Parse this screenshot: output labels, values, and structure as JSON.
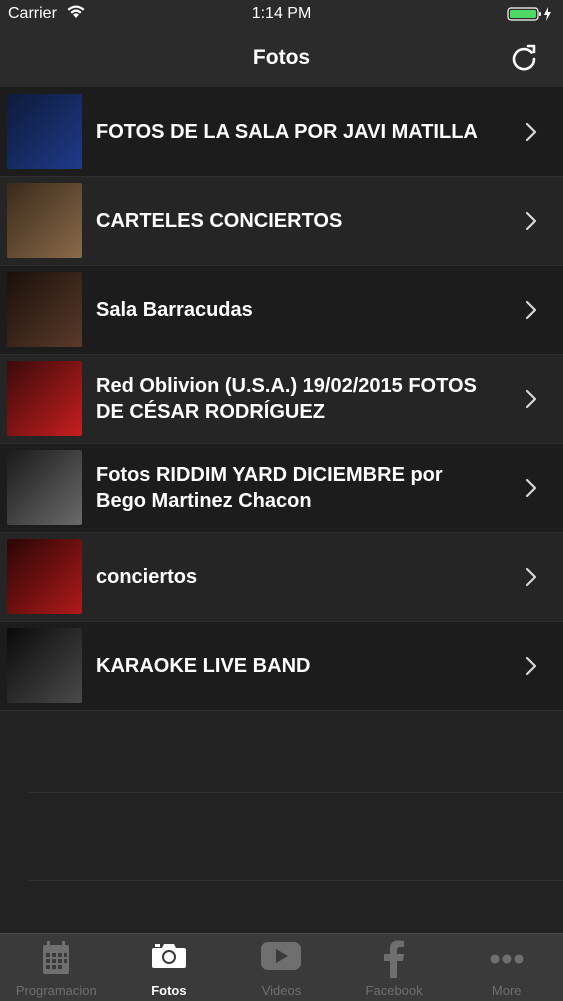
{
  "status_bar": {
    "carrier": "Carrier",
    "time": "1:14 PM",
    "wifi_icon": "wifi-icon",
    "battery_icon": "battery-charging-icon",
    "battery_color": "#4cd964"
  },
  "nav": {
    "title": "Fotos",
    "refresh_icon": "refresh-icon"
  },
  "albums": [
    {
      "label": "FOTOS DE LA SALA POR JAVI MATILLA",
      "thumb_colors": [
        "#0d1a3a",
        "#1f3a8a"
      ]
    },
    {
      "label": "CARTELES CONCIERTOS",
      "thumb_colors": [
        "#3a2a1a",
        "#8a6a4a"
      ]
    },
    {
      "label": "Sala Barracudas",
      "thumb_colors": [
        "#1a0f0a",
        "#5a3a2a"
      ]
    },
    {
      "label": "Red Oblivion (U.S.A.) 19/02/2015 FOTOS DE CÉSAR RODRÍGUEZ",
      "thumb_colors": [
        "#3a0a0a",
        "#c81e1e"
      ]
    },
    {
      "label": "Fotos RIDDIM YARD DICIEMBRE por Bego Martinez Chacon",
      "thumb_colors": [
        "#1a1a1a",
        "#6a6a6a"
      ]
    },
    {
      "label": "conciertos",
      "thumb_colors": [
        "#2a0505",
        "#b01a1a"
      ]
    },
    {
      "label": "KARAOKE LIVE BAND",
      "thumb_colors": [
        "#0a0a0a",
        "#4a4a4a"
      ]
    }
  ],
  "tabs": [
    {
      "label": "Programacion",
      "icon": "calendar-icon",
      "active": false
    },
    {
      "label": "Fotos",
      "icon": "camera-icon",
      "active": true
    },
    {
      "label": "Videos",
      "icon": "play-icon",
      "active": false
    },
    {
      "label": "Facebook",
      "icon": "facebook-icon",
      "active": false
    },
    {
      "label": "More",
      "icon": "more-icon",
      "active": false
    }
  ],
  "colors": {
    "background": "#222222",
    "active_tab": "#ffffff",
    "inactive_tab": "#6f6f6f"
  }
}
